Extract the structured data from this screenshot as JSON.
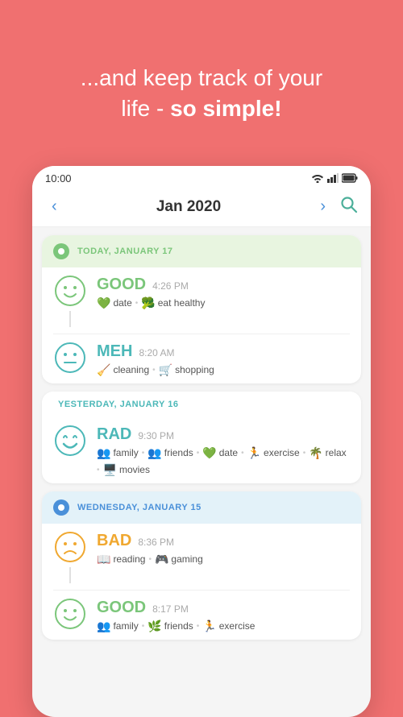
{
  "header": {
    "line1": "...and keep track of your",
    "line2_normal": "life - ",
    "line2_bold": "so simple!"
  },
  "status_bar": {
    "time": "10:00"
  },
  "nav": {
    "prev": "‹",
    "title": "Jan 2020",
    "next": "›"
  },
  "days": [
    {
      "id": "today",
      "type": "today",
      "label": "TODAY, JANUARY 17",
      "dot_color": "green",
      "entries": [
        {
          "mood": "GOOD",
          "mood_class": "good",
          "face_type": "happy",
          "time": "4:26 PM",
          "tags": [
            {
              "icon": "💚",
              "text": "date"
            },
            {
              "icon": "🥦",
              "text": "eat healthy"
            }
          ]
        },
        {
          "mood": "MEH",
          "mood_class": "meh",
          "face_type": "neutral",
          "time": "8:20 AM",
          "tags": [
            {
              "icon": "🧹",
              "text": "cleaning"
            },
            {
              "icon": "🛒",
              "text": "shopping"
            }
          ]
        }
      ]
    },
    {
      "id": "yesterday",
      "type": "yesterday",
      "label": "YESTERDAY, JANUARY 16",
      "dot_color": "none",
      "entries": [
        {
          "mood": "RAD",
          "mood_class": "rad",
          "face_type": "rad",
          "time": "9:30 PM",
          "tags": [
            {
              "icon": "👥",
              "text": "family"
            },
            {
              "icon": "👥",
              "text": "friends"
            },
            {
              "icon": "💚",
              "text": "date"
            },
            {
              "icon": "🏃",
              "text": "exercise"
            },
            {
              "icon": "🌴",
              "text": "relax"
            },
            {
              "icon": "🖥️",
              "text": "movies"
            }
          ]
        }
      ]
    },
    {
      "id": "wednesday",
      "type": "wednesday",
      "label": "WEDNESDAY, JANUARY 15",
      "dot_color": "blue",
      "entries": [
        {
          "mood": "BAD",
          "mood_class": "bad",
          "face_type": "bad",
          "time": "8:36 PM",
          "tags": [
            {
              "icon": "📖",
              "text": "reading"
            },
            {
              "icon": "🎮",
              "text": "gaming"
            }
          ]
        },
        {
          "mood": "GOOD",
          "mood_class": "good",
          "face_type": "happy",
          "time": "8:17 PM",
          "tags": [
            {
              "icon": "👥",
              "text": "family"
            },
            {
              "icon": "🌿",
              "text": "friends"
            },
            {
              "icon": "🏃",
              "text": "exercise"
            }
          ]
        }
      ]
    }
  ]
}
